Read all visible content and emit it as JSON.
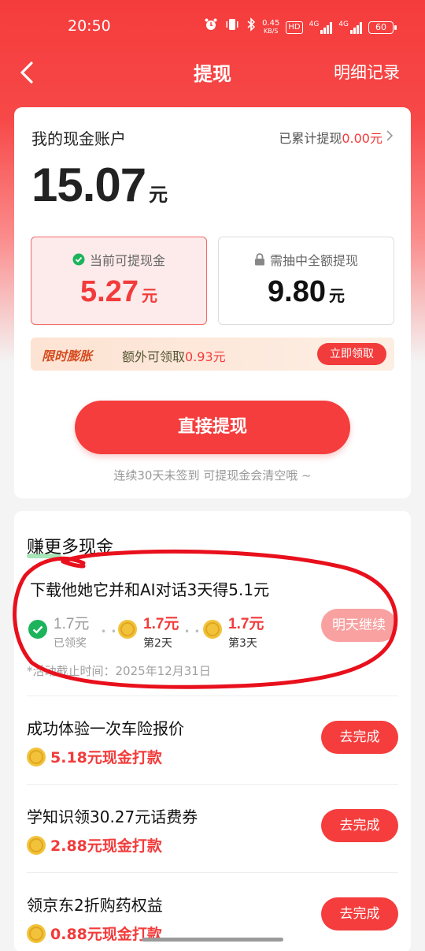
{
  "status_bar": {
    "time": "20:50",
    "speed_value": "0.45",
    "speed_unit": "KB/S",
    "hd": "HD",
    "net1": "4G",
    "net2": "4G",
    "battery": "60"
  },
  "nav": {
    "title": "提现",
    "right": "明细记录"
  },
  "account": {
    "title": "我的现金账户",
    "withdrawn_label": "已累计提现",
    "withdrawn_amount": "0.00元",
    "balance": "15.07",
    "balance_unit": "元",
    "available_label": "当前可提现金",
    "available_value": "5.27",
    "available_unit": "元",
    "locked_label": "需抽中全额提现",
    "locked_value": "9.80",
    "locked_unit": "元",
    "promo_tag": "限时膨胀",
    "promo_text": "额外可领取",
    "promo_amount": "0.93元",
    "promo_button": "立即领取",
    "withdraw_button": "直接提现",
    "note": "连续30天未签到 可提现金会清空哦 ~"
  },
  "tasks": {
    "title": "赚更多现金",
    "featured": {
      "title": "下载他她它并和AI对话3天得5.1元",
      "steps": [
        {
          "amount": "1.7元",
          "label": "已领奖"
        },
        {
          "amount": "1.7元",
          "label": "第2天"
        },
        {
          "amount": "1.7元",
          "label": "第3天"
        }
      ],
      "button": "明天继续",
      "deadline": "*活动截止时间：2025年12月31日"
    },
    "items": [
      {
        "title": "成功体验一次车险报价",
        "reward": "5.18元现金打款",
        "button": "去完成"
      },
      {
        "title": "学知识领30.27元话费券",
        "reward": "2.88元现金打款",
        "button": "去完成"
      },
      {
        "title": "领京东2折购药权益",
        "reward": "0.88元现金打款",
        "button": "去完成"
      }
    ]
  },
  "colors": {
    "accent": "#f53d3d",
    "success": "#1db35b",
    "coin": "#f2c23a"
  }
}
